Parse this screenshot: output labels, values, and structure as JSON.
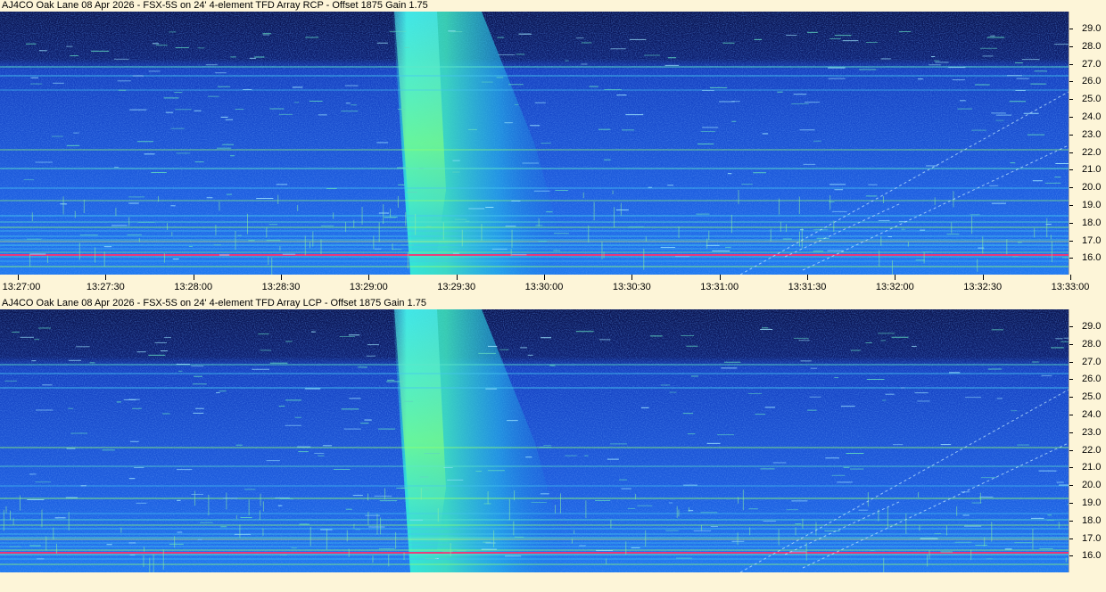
{
  "panels": [
    {
      "title": "AJ4CO Oak Lane 08 Apr 2026 - FSX-5S on 24' 4-element TFD Array RCP  -  Offset 1875  Gain 1.75",
      "show_time_axis": true
    },
    {
      "title": "AJ4CO Oak Lane 08 Apr 2026 - FSX-5S on 24' 4-element TFD Array LCP  -  Offset 1875  Gain 1.75",
      "show_time_axis": false
    }
  ],
  "freq_labels": [
    "29.0",
    "28.0",
    "27.0",
    "26.0",
    "25.0",
    "24.0",
    "23.0",
    "22.0",
    "21.0",
    "20.0",
    "19.0",
    "18.0",
    "17.0",
    "16.0"
  ],
  "time_labels": [
    "13:27:00",
    "13:27:30",
    "13:28:00",
    "13:28:30",
    "13:29:00",
    "13:29:30",
    "13:30:00",
    "13:30:30",
    "13:31:00",
    "13:31:30",
    "13:32:00",
    "13:32:30",
    "13:33:00"
  ],
  "colors": {
    "background": "#fdf5d8",
    "spectrum_dark": "#0a1a5c",
    "spectrum_mid": "#1a4fd0",
    "burst": "#33ffd0",
    "interference_red": "#ff3070"
  }
}
